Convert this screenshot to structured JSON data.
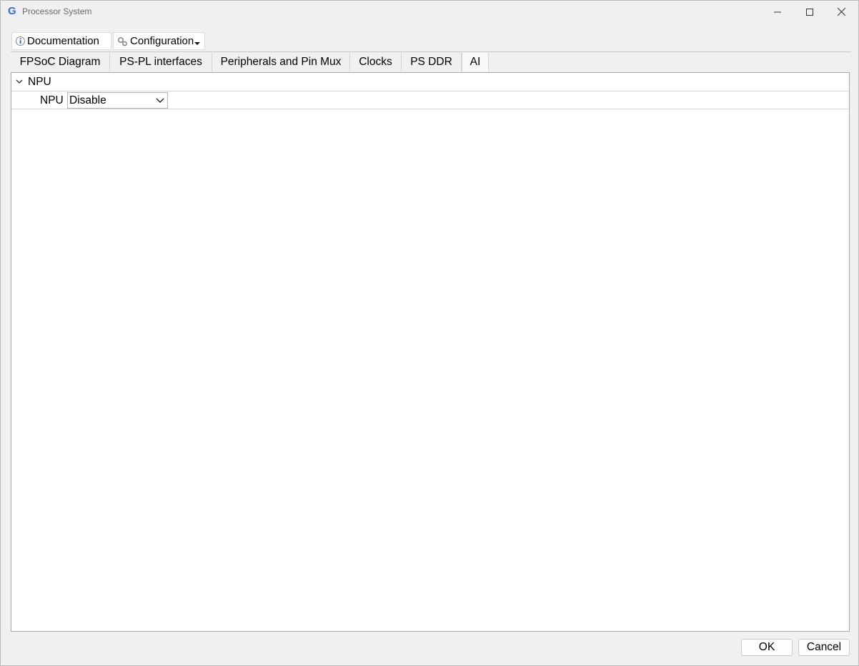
{
  "window": {
    "title": "Processor System",
    "logo_letter": "G"
  },
  "toolbar": {
    "documentation_label": "Documentation",
    "configuration_label": "Configuration",
    "documentation_icon": "info-icon",
    "configuration_icon": "gears-icon"
  },
  "tabs": [
    {
      "label": "FPSoC Diagram",
      "active": false
    },
    {
      "label": "PS-PL interfaces",
      "active": false
    },
    {
      "label": "Peripherals and Pin Mux",
      "active": false
    },
    {
      "label": "Clocks",
      "active": false
    },
    {
      "label": "PS DDR",
      "active": false
    },
    {
      "label": "AI",
      "active": true
    }
  ],
  "section": {
    "title": "NPU",
    "expanded": true,
    "rows": [
      {
        "label": "NPU",
        "value": "Disable"
      }
    ]
  },
  "footer": {
    "ok_label": "OK",
    "cancel_label": "Cancel"
  },
  "colors": {
    "logo": "#2f6fd6",
    "panel_bg": "#ffffff",
    "window_bg": "#f0f0f0"
  }
}
